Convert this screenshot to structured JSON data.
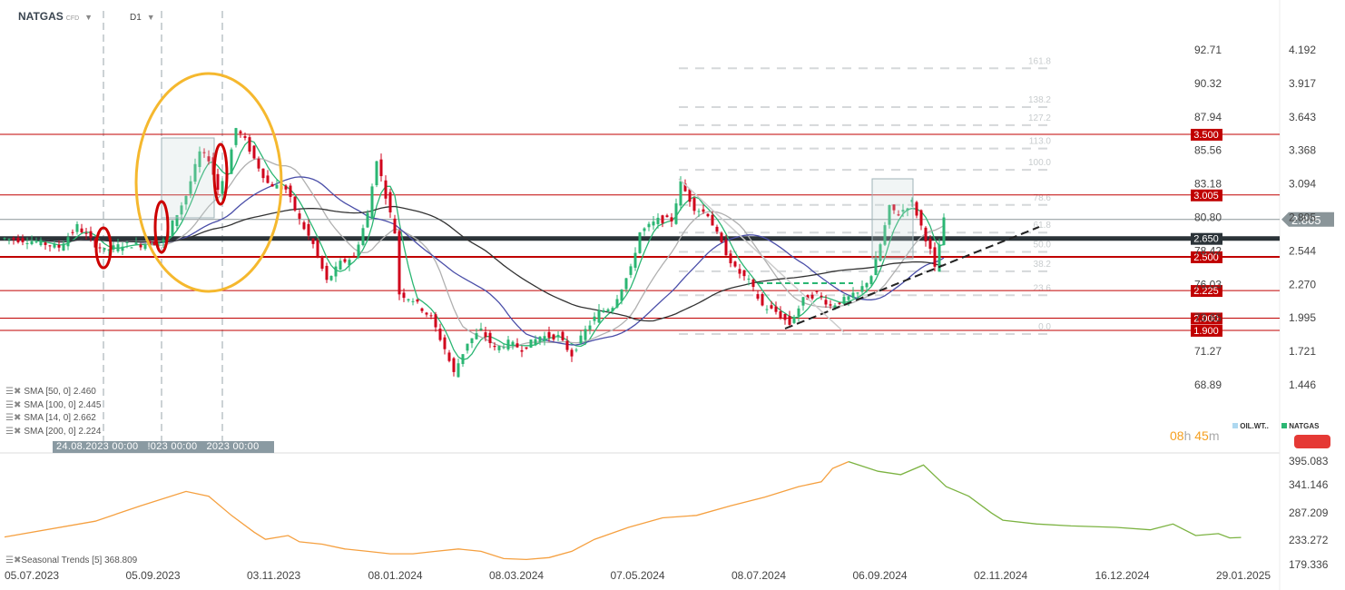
{
  "header": {
    "symbol": "NATGAS",
    "symbol_type": "CFD",
    "timeframe": "D1"
  },
  "legend": [
    {
      "label": "SMA [50, 0] 2.460"
    },
    {
      "label": "SMA [100, 0] 2.445"
    },
    {
      "label": "SMA [14, 0] 2.662"
    },
    {
      "label": "SMA [200, 0] 2.224"
    }
  ],
  "crosshair_dates": [
    "24.08.2023 00:00",
    "!023 00:00",
    "2023 00:00"
  ],
  "timer": {
    "hours": "08",
    "h": "h",
    "minutes": "45",
    "m": "m"
  },
  "instrument_tabs": [
    {
      "label": "OIL.WT..",
      "color": "#aed8f0"
    },
    {
      "label": "NATGAS",
      "color": "#2bb673"
    }
  ],
  "seasonal_label": "Seasonal  Trends [5] 368.809",
  "colors": {
    "up": "#2bb673",
    "down": "#d0021b",
    "level": "#c00000",
    "support": "#2b3338",
    "current": "#8a9599",
    "sma14": "#2bb673",
    "sma50": "#b0b0b0",
    "sma100": "#4a4ea8",
    "sma200": "#333333",
    "seasonal_past": "#f5a040",
    "seasonal_future": "#7cb342",
    "ellipse": "#f5b82e"
  },
  "chart_data": {
    "type": "candlestick",
    "title": "NATGAS CFD D1",
    "x_ticks": [
      "05.07.2023",
      "05.09.2023",
      "03.11.2023",
      "08.01.2024",
      "08.03.2024",
      "07.05.2024",
      "08.07.2024",
      "06.09.2024",
      "02.11.2024",
      "16.12.2024",
      "29.01.2025"
    ],
    "y_ticks_right": [
      "4.192",
      "3.917",
      "3.643",
      "3.368",
      "3.094",
      "2.805",
      "2.544",
      "2.270",
      "1.995",
      "1.721",
      "1.446"
    ],
    "y_ticks_left": [
      "92.71",
      "90.32",
      "87.94",
      "85.56",
      "83.18",
      "80.80",
      "78.42",
      "76.03",
      "73.65",
      "71.27",
      "68.89"
    ],
    "current_price": "2.805",
    "price_path": [
      [
        0,
        2.65
      ],
      [
        6,
        2.63
      ],
      [
        12,
        2.58
      ],
      [
        16,
        2.75
      ],
      [
        20,
        2.6
      ],
      [
        22,
        2.55
      ],
      [
        26,
        2.6
      ],
      [
        30,
        2.6
      ],
      [
        35,
        2.63
      ],
      [
        38,
        2.85
      ],
      [
        40,
        3.0
      ],
      [
        43,
        3.35
      ],
      [
        45,
        3.3
      ],
      [
        47,
        3.05
      ],
      [
        49,
        3.2
      ],
      [
        51,
        3.55
      ],
      [
        53,
        3.45
      ],
      [
        55,
        3.3
      ],
      [
        58,
        3.1
      ],
      [
        62,
        3.05
      ],
      [
        65,
        2.8
      ],
      [
        68,
        2.6
      ],
      [
        71,
        2.3
      ],
      [
        74,
        2.45
      ],
      [
        77,
        2.5
      ],
      [
        80,
        2.85
      ],
      [
        82,
        3.3
      ],
      [
        84,
        3.0
      ],
      [
        86,
        2.7
      ],
      [
        87,
        2.2
      ],
      [
        90,
        2.15
      ],
      [
        94,
        2.0
      ],
      [
        97,
        1.75
      ],
      [
        99,
        1.55
      ],
      [
        102,
        1.8
      ],
      [
        105,
        1.9
      ],
      [
        108,
        1.75
      ],
      [
        111,
        1.8
      ],
      [
        114,
        1.75
      ],
      [
        118,
        1.85
      ],
      [
        122,
        1.85
      ],
      [
        125,
        1.7
      ],
      [
        128,
        1.9
      ],
      [
        131,
        2.05
      ],
      [
        134,
        2.1
      ],
      [
        138,
        2.4
      ],
      [
        140,
        2.7
      ],
      [
        144,
        2.8
      ],
      [
        147,
        2.8
      ],
      [
        149,
        3.1
      ],
      [
        152,
        2.9
      ],
      [
        155,
        2.85
      ],
      [
        158,
        2.6
      ],
      [
        161,
        2.4
      ],
      [
        164,
        2.3
      ],
      [
        167,
        2.1
      ],
      [
        170,
        2.05
      ],
      [
        173,
        1.95
      ],
      [
        176,
        2.15
      ],
      [
        179,
        2.2
      ],
      [
        182,
        2.1
      ],
      [
        185,
        2.15
      ],
      [
        188,
        2.2
      ],
      [
        191,
        2.35
      ],
      [
        193,
        2.6
      ],
      [
        195,
        2.9
      ],
      [
        197,
        2.85
      ],
      [
        200,
        2.95
      ],
      [
        202,
        2.75
      ],
      [
        204,
        2.55
      ],
      [
        205,
        2.4
      ],
      [
        207,
        2.8
      ]
    ],
    "horizontal_levels": [
      {
        "value": 3.5,
        "label": "3.500",
        "style": "level"
      },
      {
        "value": 3.005,
        "label": "3.005",
        "style": "level"
      },
      {
        "value": 2.805,
        "label": "",
        "style": "current"
      },
      {
        "value": 2.65,
        "label": "2.650",
        "style": "support"
      },
      {
        "value": 2.5,
        "label": "2.500",
        "style": "level"
      },
      {
        "value": 2.225,
        "label": "2.225",
        "style": "level"
      },
      {
        "value": 2.0,
        "label": "2.000",
        "style": "level"
      },
      {
        "value": 1.9,
        "label": "1.900",
        "style": "level"
      }
    ],
    "fibonacci": {
      "low": 1.87,
      "high": 3.21,
      "levels": [
        "0.0",
        "23.6",
        "38.2",
        "50.0",
        "61.8",
        "78.6",
        "100.0",
        "113.0",
        "127.2",
        "138.2",
        "161.8"
      ]
    },
    "seasonal": {
      "y_ticks": [
        "395.083",
        "341.146",
        "287.209",
        "233.272",
        "179.336"
      ],
      "past": [
        [
          0,
          235
        ],
        [
          40,
          268
        ],
        [
          60,
          300
        ],
        [
          80,
          330
        ],
        [
          90,
          320
        ],
        [
          100,
          280
        ],
        [
          110,
          245
        ],
        [
          115,
          230
        ],
        [
          125,
          238
        ],
        [
          130,
          225
        ],
        [
          140,
          220
        ],
        [
          150,
          210
        ],
        [
          160,
          205
        ],
        [
          170,
          200
        ],
        [
          180,
          200
        ],
        [
          190,
          205
        ],
        [
          200,
          210
        ],
        [
          210,
          205
        ],
        [
          220,
          190
        ],
        [
          230,
          188
        ],
        [
          240,
          192
        ],
        [
          250,
          205
        ],
        [
          260,
          230
        ],
        [
          275,
          255
        ],
        [
          290,
          275
        ],
        [
          305,
          280
        ],
        [
          320,
          300
        ],
        [
          335,
          318
        ],
        [
          350,
          340
        ],
        [
          360,
          350
        ],
        [
          365,
          378
        ],
        [
          372,
          392
        ]
      ],
      "future": [
        [
          372,
          392
        ],
        [
          385,
          372
        ],
        [
          395,
          365
        ],
        [
          405,
          385
        ],
        [
          415,
          340
        ],
        [
          425,
          320
        ],
        [
          435,
          285
        ],
        [
          440,
          270
        ],
        [
          455,
          262
        ],
        [
          470,
          258
        ],
        [
          490,
          255
        ],
        [
          505,
          250
        ],
        [
          515,
          262
        ],
        [
          525,
          238
        ],
        [
          535,
          242
        ],
        [
          540,
          233
        ],
        [
          545,
          234
        ]
      ]
    }
  }
}
